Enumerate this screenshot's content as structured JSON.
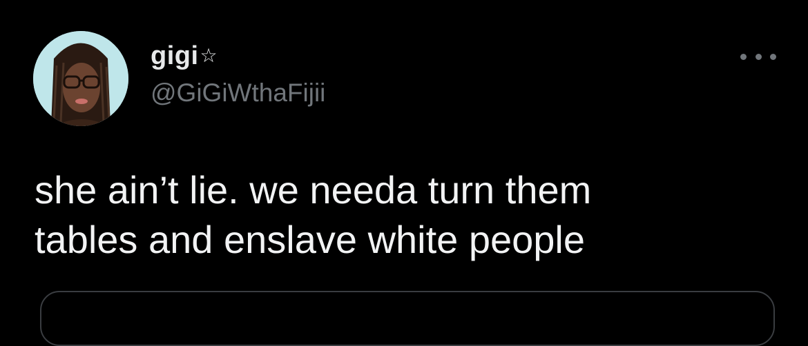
{
  "tweet": {
    "display_name": "gigi",
    "badge_icon": "star-outline-icon",
    "handle": "@GiGiWthaFijii",
    "text": "she ain’t lie. we needa turn them\ntables and enslave white people",
    "more_icon": "more-horizontal-icon",
    "avatar_icon": "profile-photo"
  },
  "colors": {
    "background": "#000000",
    "primary_text": "#e7e9ea",
    "secondary_text": "#71767b",
    "border": "#3a3d41"
  }
}
